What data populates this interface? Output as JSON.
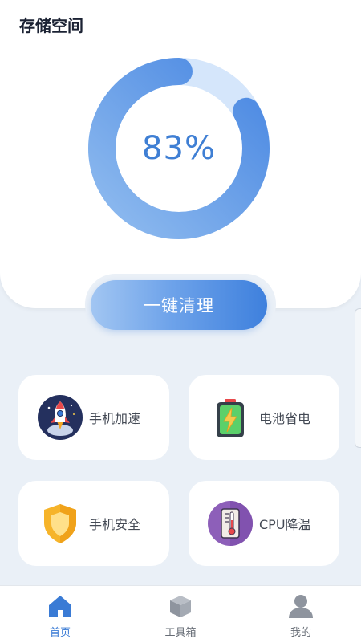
{
  "header": {
    "title": "存储空间"
  },
  "storage": {
    "percent_text": "83%",
    "usage_fraction": 0.83
  },
  "actions": {
    "clean_label": "一键清理"
  },
  "tools": [
    {
      "label": "手机加速",
      "icon": "rocket-icon"
    },
    {
      "label": "电池省电",
      "icon": "battery-icon"
    },
    {
      "label": "手机安全",
      "icon": "shield-icon"
    },
    {
      "label": "CPU降温",
      "icon": "thermometer-icon"
    }
  ],
  "nav": [
    {
      "label": "首页",
      "icon": "home-icon",
      "active": true
    },
    {
      "label": "工具箱",
      "icon": "toolbox-icon",
      "active": false
    },
    {
      "label": "我的",
      "icon": "user-icon",
      "active": false
    }
  ],
  "colors": {
    "accent": "#3a7bd5",
    "ring_track": "#d5e6fb",
    "ring_fill": "#5c97e6",
    "background": "#eaf0f7"
  }
}
